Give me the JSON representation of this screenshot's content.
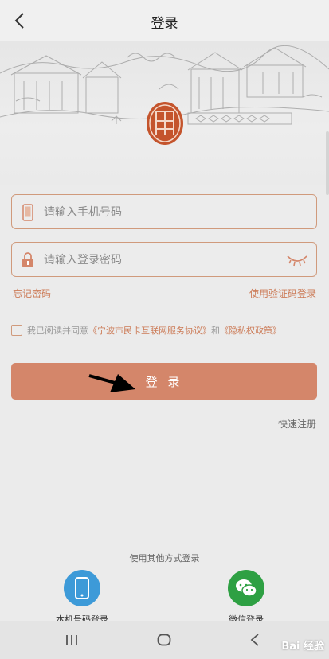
{
  "header": {
    "title": "登录"
  },
  "form": {
    "phone_placeholder": "请输入手机号码",
    "password_placeholder": "请输入登录密码",
    "forgot_password": "忘记密码",
    "sms_login": "使用验证码登录",
    "agree_prefix": "我已阅读并同意",
    "agreement_service": "《宁波市民卡互联网服务协议》",
    "agree_and": "和",
    "agreement_privacy": "《隐私权政策》",
    "login_label": "登 录",
    "quick_register": "快速注册"
  },
  "other_login": {
    "title": "使用其他方式登录",
    "phone_number_login": "本机号码登录",
    "wechat_login": "微信登录"
  },
  "watermark": {
    "text": "Bai 经验"
  },
  "colors": {
    "accent": "#d4866a",
    "link": "#cc7b57",
    "phone_login_icon": "#3d9ad8",
    "wechat_icon": "#2ea043"
  },
  "icons": {
    "back": "chevron-left-icon",
    "phone_field": "phone-icon",
    "password_field": "lock-icon",
    "password_toggle": "eye-closed-icon",
    "phone_number_login": "phone-icon",
    "wechat_login": "wechat-icon",
    "annotation": "arrow-icon"
  }
}
